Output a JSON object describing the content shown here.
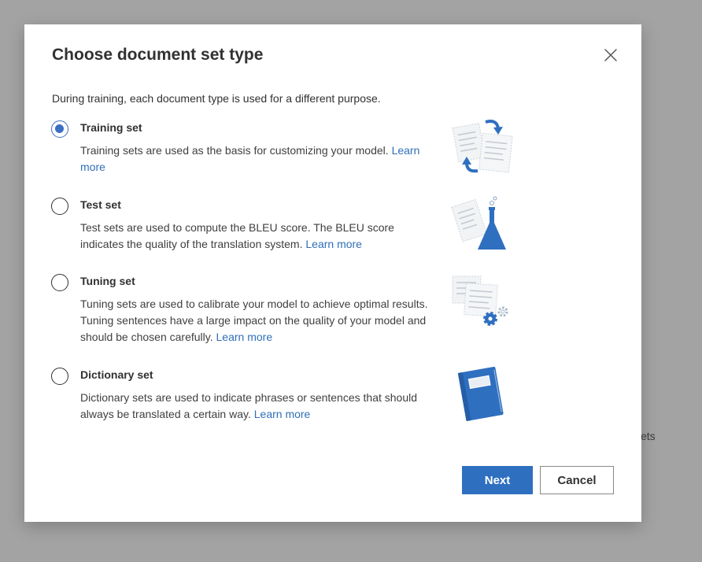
{
  "background": {
    "text": "ets"
  },
  "dialog": {
    "title": "Choose document set type",
    "subtitle": "During training, each document type is used for a different purpose.",
    "close_icon": "close-icon",
    "options": [
      {
        "label": "Training set",
        "description": "Training sets are used as the basis for customizing your model.",
        "link": "Learn more",
        "checked": true,
        "icon": "documents-sync-icon"
      },
      {
        "label": "Test set",
        "description": "Test sets are used to compute the BLEU score. The BLEU score indicates the quality of the translation system.",
        "link": "Learn more",
        "checked": false,
        "icon": "documents-flask-icon"
      },
      {
        "label": "Tuning set",
        "description": "Tuning sets are used to calibrate your model to achieve optimal results. Tuning sentences have a large impact on the quality of your model and should be chosen carefully.",
        "link": "Learn more",
        "checked": false,
        "icon": "documents-gears-icon"
      },
      {
        "label": "Dictionary set",
        "description": "Dictionary sets are used to indicate phrases or sentences that should always be translated a certain way.",
        "link": "Learn more",
        "checked": false,
        "icon": "notebook-icon"
      }
    ],
    "next_label": "Next",
    "cancel_label": "Cancel"
  },
  "colors": {
    "accent": "#2f6fc0",
    "link": "#2f6fb8",
    "overlay": "#a3a3a3"
  }
}
